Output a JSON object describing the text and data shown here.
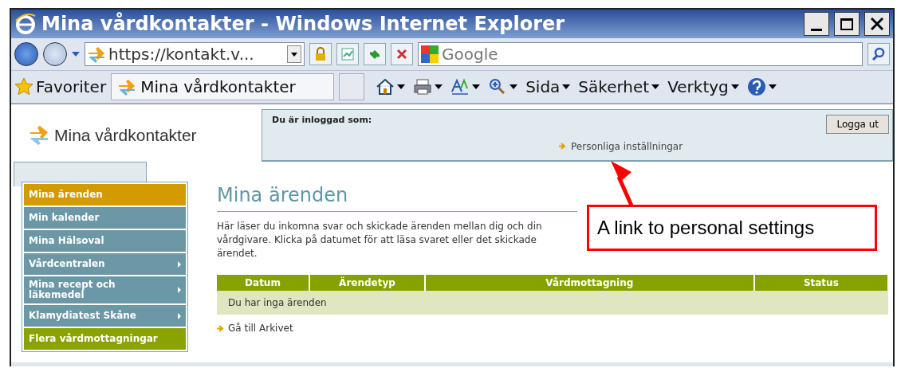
{
  "window": {
    "title": "Mina vårdkontakter - Windows Internet Explorer"
  },
  "address_bar": {
    "url": "https://kontakt.v...",
    "search_placeholder": "Google"
  },
  "favorites_bar": {
    "favorites_label": "Favoriter",
    "tab_title": "Mina vårdkontakter",
    "menus": [
      "Sida",
      "Säkerhet",
      "Verktyg"
    ]
  },
  "page": {
    "logo_text": "Mina vårdkontakter",
    "logged_in_label": "Du är inloggad som:",
    "settings_link": "Personliga inställningar",
    "logout_button": "Logga ut",
    "sidebar": {
      "items": [
        {
          "label": "Mina ärenden",
          "selected": true,
          "kind": "menu",
          "submenu": false
        },
        {
          "label": "Min kalender",
          "selected": false,
          "kind": "menu",
          "submenu": false
        },
        {
          "label": "Mina Hälsoval",
          "selected": false,
          "kind": "menu",
          "submenu": false
        },
        {
          "label": "Vårdcentralen",
          "selected": false,
          "kind": "menu",
          "submenu": true
        },
        {
          "label": "Mina recept och läkemedel",
          "selected": false,
          "kind": "menu",
          "submenu": true
        },
        {
          "label": "Klamydiatest Skåne",
          "selected": false,
          "kind": "menu",
          "submenu": true
        },
        {
          "label": "Flera vårdmottagningar",
          "selected": false,
          "kind": "accent",
          "submenu": false
        }
      ]
    },
    "heading": "Mina ärenden",
    "intro": "Här läser du inkomna svar och skickade ärenden mellan dig och din vårdgivare. Klicka på datumet för att läsa svaret eller det skickade ärendet.",
    "table": {
      "columns": [
        "Datum",
        "Ärendetyp",
        "Vårdmottagning",
        "Status"
      ],
      "empty_message": "Du har inga ärenden"
    },
    "archive_link": "Gå till Arkivet"
  },
  "annotation": {
    "text": "A link to personal settings"
  }
}
